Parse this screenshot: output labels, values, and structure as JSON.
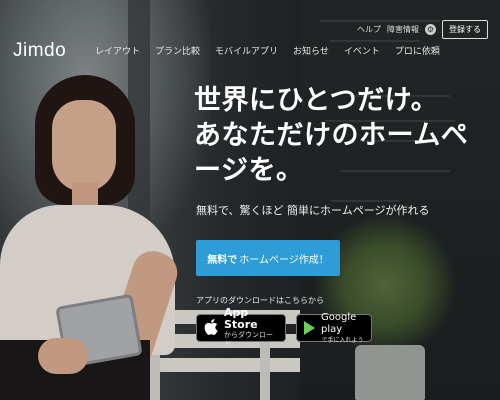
{
  "header": {
    "logo": "Jimdo",
    "utility": {
      "help": "ヘルプ",
      "outage": "障害情報",
      "login": "登録する"
    },
    "nav": [
      "レイアウト",
      "プラン比較",
      "モバイルアプリ",
      "お知らせ",
      "イベント",
      "プロに依頼"
    ]
  },
  "hero": {
    "headline_lines": [
      "世界にひとつだけ。",
      "あなただけのホームペ",
      "ージを。"
    ],
    "subline": "無料で、驚くほど 簡単にホームページが作れる",
    "cta": {
      "bold": "無料で",
      "text": "ホームページ作成！"
    },
    "app_download_label": "アプリのダウンロードはこちらから",
    "app_store": {
      "line1": "App Store",
      "line2": "からダウンロード"
    },
    "google_play": {
      "line1": "Google play",
      "line2": "で手に入れよう"
    }
  },
  "icons": {
    "gear": "gear-icon",
    "apple": "apple-icon",
    "play": "google-play-icon"
  },
  "colors": {
    "cta_background": "#2e9cd6",
    "text": "#ffffff"
  }
}
